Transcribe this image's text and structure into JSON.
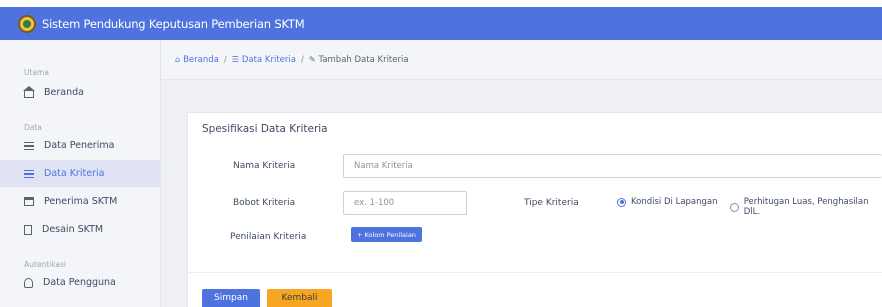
{
  "app": {
    "title": "Sistem Pendukung Keputusan Pemberian SKTM",
    "brand_color": "#4e73df"
  },
  "sidebar": {
    "sections": [
      {
        "label": "Utama"
      },
      {
        "label": "Data"
      },
      {
        "label": "Autentikasi"
      }
    ],
    "items": [
      {
        "label": "Beranda",
        "icon": "home-icon"
      },
      {
        "label": "Data Penerima",
        "icon": "list-icon"
      },
      {
        "label": "Data Kriteria",
        "icon": "list-icon",
        "active": true
      },
      {
        "label": "Penerima SKTM",
        "icon": "calendar-icon"
      },
      {
        "label": "Desain SKTM",
        "icon": "document-icon"
      },
      {
        "label": "Data Pengguna",
        "icon": "user-icon"
      }
    ]
  },
  "breadcrumb": {
    "home": "Beranda",
    "parent": "Data Kriteria",
    "current": "Tambah Data Kriteria",
    "separator": "/"
  },
  "form": {
    "title": "Spesifikasi Data Kriteria",
    "nama": {
      "label": "Nama Kriteria",
      "placeholder": "Nama Kriteria"
    },
    "bobot": {
      "label": "Bobot Kriteria",
      "placeholder": "ex. 1-100"
    },
    "tipe": {
      "label": "Tipe Kriteria",
      "options": [
        {
          "label": "Kondisi Di Lapangan",
          "selected": true
        },
        {
          "label": "Perhitugan Luas, Penghasilan DlL.",
          "selected": false
        }
      ]
    },
    "penilaian": {
      "label": "Penilaian Kriteria",
      "button": "+ Kolom Penilaian"
    },
    "save_label": "Simpan",
    "back_label": "Kembali"
  }
}
